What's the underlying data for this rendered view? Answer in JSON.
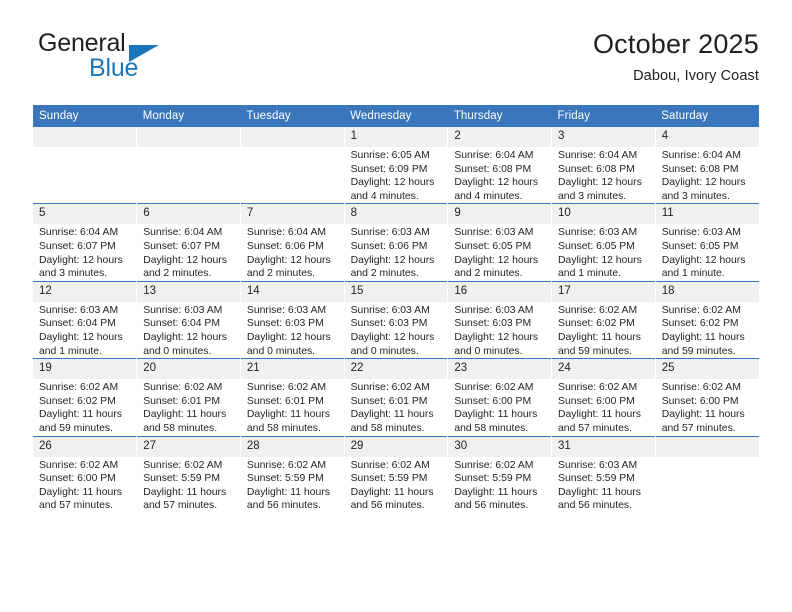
{
  "brand": {
    "name_top": "General",
    "name_bottom": "Blue",
    "triangle_icon": "blue-triangle-icon",
    "color_dark": "#231f20",
    "color_blue": "#1b75bb"
  },
  "header": {
    "title": "October 2025",
    "subtitle": "Dabou, Ivory Coast"
  },
  "theme": {
    "header_row_bg": "#3a76bc",
    "header_row_text": "#ffffff",
    "daynum_bg": "#f0f0f0",
    "cell_bg": "#ffffff",
    "text": "#231f20"
  },
  "calendar": {
    "weekday_headers": [
      "Sunday",
      "Monday",
      "Tuesday",
      "Wednesday",
      "Thursday",
      "Friday",
      "Saturday"
    ],
    "weeks": [
      [
        {
          "day": "",
          "empty": true,
          "sunrise": "",
          "sunset": "",
          "daylight_line1": "",
          "daylight_line2": ""
        },
        {
          "day": "",
          "empty": true,
          "sunrise": "",
          "sunset": "",
          "daylight_line1": "",
          "daylight_line2": ""
        },
        {
          "day": "",
          "empty": true,
          "sunrise": "",
          "sunset": "",
          "daylight_line1": "",
          "daylight_line2": ""
        },
        {
          "day": "1",
          "sunrise": "Sunrise: 6:05 AM",
          "sunset": "Sunset: 6:09 PM",
          "daylight_line1": "Daylight: 12 hours",
          "daylight_line2": "and 4 minutes."
        },
        {
          "day": "2",
          "sunrise": "Sunrise: 6:04 AM",
          "sunset": "Sunset: 6:08 PM",
          "daylight_line1": "Daylight: 12 hours",
          "daylight_line2": "and 4 minutes."
        },
        {
          "day": "3",
          "sunrise": "Sunrise: 6:04 AM",
          "sunset": "Sunset: 6:08 PM",
          "daylight_line1": "Daylight: 12 hours",
          "daylight_line2": "and 3 minutes."
        },
        {
          "day": "4",
          "sunrise": "Sunrise: 6:04 AM",
          "sunset": "Sunset: 6:08 PM",
          "daylight_line1": "Daylight: 12 hours",
          "daylight_line2": "and 3 minutes."
        }
      ],
      [
        {
          "day": "5",
          "sunrise": "Sunrise: 6:04 AM",
          "sunset": "Sunset: 6:07 PM",
          "daylight_line1": "Daylight: 12 hours",
          "daylight_line2": "and 3 minutes."
        },
        {
          "day": "6",
          "sunrise": "Sunrise: 6:04 AM",
          "sunset": "Sunset: 6:07 PM",
          "daylight_line1": "Daylight: 12 hours",
          "daylight_line2": "and 2 minutes."
        },
        {
          "day": "7",
          "sunrise": "Sunrise: 6:04 AM",
          "sunset": "Sunset: 6:06 PM",
          "daylight_line1": "Daylight: 12 hours",
          "daylight_line2": "and 2 minutes."
        },
        {
          "day": "8",
          "sunrise": "Sunrise: 6:03 AM",
          "sunset": "Sunset: 6:06 PM",
          "daylight_line1": "Daylight: 12 hours",
          "daylight_line2": "and 2 minutes."
        },
        {
          "day": "9",
          "sunrise": "Sunrise: 6:03 AM",
          "sunset": "Sunset: 6:05 PM",
          "daylight_line1": "Daylight: 12 hours",
          "daylight_line2": "and 2 minutes."
        },
        {
          "day": "10",
          "sunrise": "Sunrise: 6:03 AM",
          "sunset": "Sunset: 6:05 PM",
          "daylight_line1": "Daylight: 12 hours",
          "daylight_line2": "and 1 minute."
        },
        {
          "day": "11",
          "sunrise": "Sunrise: 6:03 AM",
          "sunset": "Sunset: 6:05 PM",
          "daylight_line1": "Daylight: 12 hours",
          "daylight_line2": "and 1 minute."
        }
      ],
      [
        {
          "day": "12",
          "sunrise": "Sunrise: 6:03 AM",
          "sunset": "Sunset: 6:04 PM",
          "daylight_line1": "Daylight: 12 hours",
          "daylight_line2": "and 1 minute."
        },
        {
          "day": "13",
          "sunrise": "Sunrise: 6:03 AM",
          "sunset": "Sunset: 6:04 PM",
          "daylight_line1": "Daylight: 12 hours",
          "daylight_line2": "and 0 minutes."
        },
        {
          "day": "14",
          "sunrise": "Sunrise: 6:03 AM",
          "sunset": "Sunset: 6:03 PM",
          "daylight_line1": "Daylight: 12 hours",
          "daylight_line2": "and 0 minutes."
        },
        {
          "day": "15",
          "sunrise": "Sunrise: 6:03 AM",
          "sunset": "Sunset: 6:03 PM",
          "daylight_line1": "Daylight: 12 hours",
          "daylight_line2": "and 0 minutes."
        },
        {
          "day": "16",
          "sunrise": "Sunrise: 6:03 AM",
          "sunset": "Sunset: 6:03 PM",
          "daylight_line1": "Daylight: 12 hours",
          "daylight_line2": "and 0 minutes."
        },
        {
          "day": "17",
          "sunrise": "Sunrise: 6:02 AM",
          "sunset": "Sunset: 6:02 PM",
          "daylight_line1": "Daylight: 11 hours",
          "daylight_line2": "and 59 minutes."
        },
        {
          "day": "18",
          "sunrise": "Sunrise: 6:02 AM",
          "sunset": "Sunset: 6:02 PM",
          "daylight_line1": "Daylight: 11 hours",
          "daylight_line2": "and 59 minutes."
        }
      ],
      [
        {
          "day": "19",
          "sunrise": "Sunrise: 6:02 AM",
          "sunset": "Sunset: 6:02 PM",
          "daylight_line1": "Daylight: 11 hours",
          "daylight_line2": "and 59 minutes."
        },
        {
          "day": "20",
          "sunrise": "Sunrise: 6:02 AM",
          "sunset": "Sunset: 6:01 PM",
          "daylight_line1": "Daylight: 11 hours",
          "daylight_line2": "and 58 minutes."
        },
        {
          "day": "21",
          "sunrise": "Sunrise: 6:02 AM",
          "sunset": "Sunset: 6:01 PM",
          "daylight_line1": "Daylight: 11 hours",
          "daylight_line2": "and 58 minutes."
        },
        {
          "day": "22",
          "sunrise": "Sunrise: 6:02 AM",
          "sunset": "Sunset: 6:01 PM",
          "daylight_line1": "Daylight: 11 hours",
          "daylight_line2": "and 58 minutes."
        },
        {
          "day": "23",
          "sunrise": "Sunrise: 6:02 AM",
          "sunset": "Sunset: 6:00 PM",
          "daylight_line1": "Daylight: 11 hours",
          "daylight_line2": "and 58 minutes."
        },
        {
          "day": "24",
          "sunrise": "Sunrise: 6:02 AM",
          "sunset": "Sunset: 6:00 PM",
          "daylight_line1": "Daylight: 11 hours",
          "daylight_line2": "and 57 minutes."
        },
        {
          "day": "25",
          "sunrise": "Sunrise: 6:02 AM",
          "sunset": "Sunset: 6:00 PM",
          "daylight_line1": "Daylight: 11 hours",
          "daylight_line2": "and 57 minutes."
        }
      ],
      [
        {
          "day": "26",
          "sunrise": "Sunrise: 6:02 AM",
          "sunset": "Sunset: 6:00 PM",
          "daylight_line1": "Daylight: 11 hours",
          "daylight_line2": "and 57 minutes."
        },
        {
          "day": "27",
          "sunrise": "Sunrise: 6:02 AM",
          "sunset": "Sunset: 5:59 PM",
          "daylight_line1": "Daylight: 11 hours",
          "daylight_line2": "and 57 minutes."
        },
        {
          "day": "28",
          "sunrise": "Sunrise: 6:02 AM",
          "sunset": "Sunset: 5:59 PM",
          "daylight_line1": "Daylight: 11 hours",
          "daylight_line2": "and 56 minutes."
        },
        {
          "day": "29",
          "sunrise": "Sunrise: 6:02 AM",
          "sunset": "Sunset: 5:59 PM",
          "daylight_line1": "Daylight: 11 hours",
          "daylight_line2": "and 56 minutes."
        },
        {
          "day": "30",
          "sunrise": "Sunrise: 6:02 AM",
          "sunset": "Sunset: 5:59 PM",
          "daylight_line1": "Daylight: 11 hours",
          "daylight_line2": "and 56 minutes."
        },
        {
          "day": "31",
          "sunrise": "Sunrise: 6:03 AM",
          "sunset": "Sunset: 5:59 PM",
          "daylight_line1": "Daylight: 11 hours",
          "daylight_line2": "and 56 minutes."
        },
        {
          "day": "",
          "empty": true,
          "sunrise": "",
          "sunset": "",
          "daylight_line1": "",
          "daylight_line2": ""
        }
      ]
    ]
  }
}
